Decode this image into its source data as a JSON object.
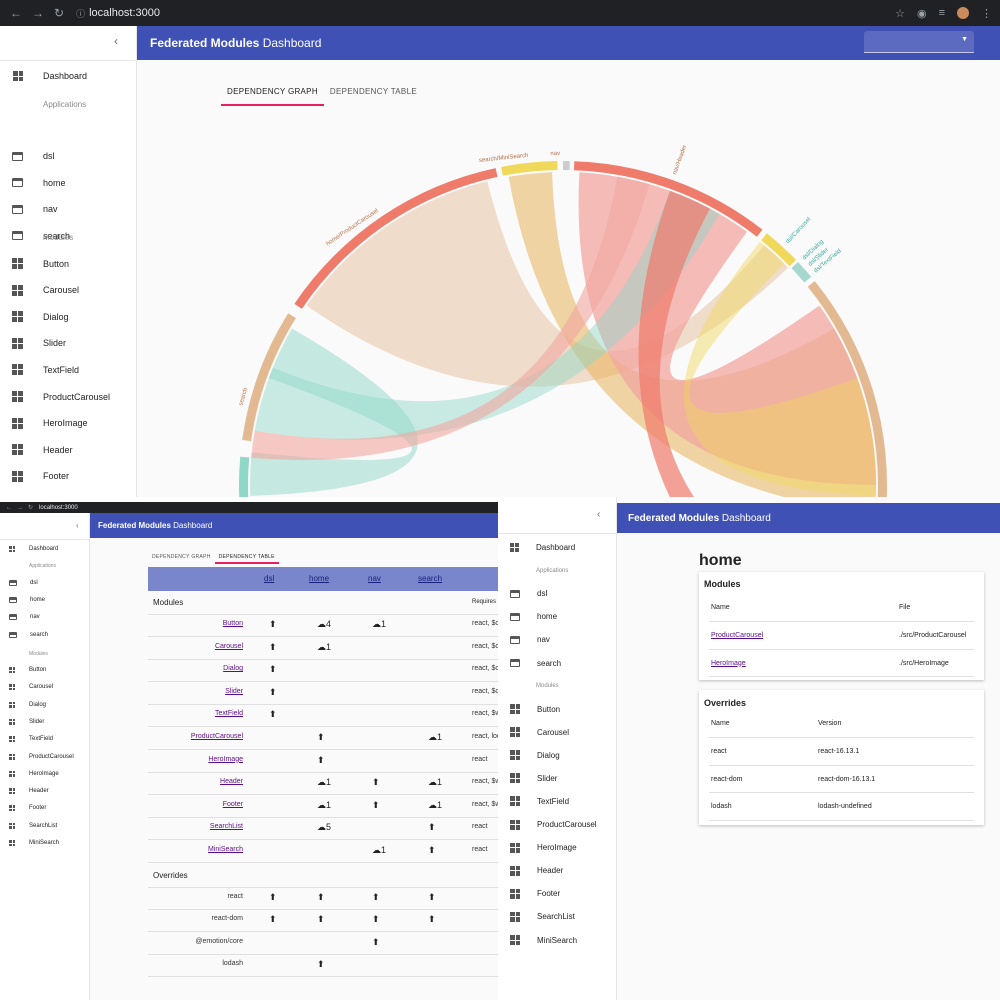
{
  "browser": {
    "url": "localhost:3000",
    "url_small": "localhost:3000"
  },
  "app": {
    "title_bold": "Federated Modules",
    "title_rest": " Dashboard"
  },
  "sidebar": {
    "dashboard": "Dashboard",
    "applications_header": "Applications",
    "applications": [
      "dsl",
      "home",
      "nav",
      "search"
    ],
    "modules_header": "Modules",
    "modules_p1": [
      "Button",
      "Carousel",
      "Dialog",
      "Slider",
      "TextField",
      "ProductCarousel",
      "HeroImage",
      "Header",
      "Footer"
    ],
    "modules": [
      "Button",
      "Carousel",
      "Dialog",
      "Slider",
      "TextField",
      "ProductCarousel",
      "HeroImage",
      "Header",
      "Footer",
      "SearchList",
      "MiniSearch"
    ]
  },
  "tabs": [
    "Dependency Graph",
    "Dependency Table"
  ],
  "graph": {
    "labels": [
      "search/MiniSearch",
      "nav",
      "home/ProductCarousel",
      "search",
      "nav/Header",
      "dsl/Carousel",
      "dsl/Dialog",
      "dsl/Slider",
      "dsl/TextField"
    ],
    "colors": {
      "salmon": "#ef7b6b",
      "yellow": "#f0d85a",
      "tan": "#e2b991",
      "teal": "#8fd7c7",
      "pink": "#f2a6a0"
    }
  },
  "table": {
    "apps": [
      "dsl",
      "home",
      "nav",
      "search"
    ],
    "modules_title": "Modules",
    "requires_title": "Requires",
    "overrides_title": "Overrides",
    "module_rows": [
      {
        "name": "Button",
        "link": true,
        "marks": [
          "⬆",
          "☁4",
          "☁1",
          ""
        ],
        "req": "react, $c"
      },
      {
        "name": "Carousel",
        "link": true,
        "marks": [
          "⬆",
          "☁1",
          "",
          ""
        ],
        "req": "react, $c"
      },
      {
        "name": "Dialog",
        "link": true,
        "marks": [
          "⬆",
          "",
          "",
          ""
        ],
        "req": "react, $c"
      },
      {
        "name": "Slider",
        "link": true,
        "marks": [
          "⬆",
          "",
          "",
          ""
        ],
        "req": "react, $c"
      },
      {
        "name": "TextField",
        "link": true,
        "marks": [
          "⬆",
          "",
          "",
          ""
        ],
        "req": "react, $w"
      },
      {
        "name": "ProductCarousel",
        "link": true,
        "marks": [
          "",
          "⬆",
          "",
          "☁1"
        ],
        "req": "react, lod"
      },
      {
        "name": "HeroImage",
        "link": true,
        "marks": [
          "",
          "⬆",
          "",
          ""
        ],
        "req": "react"
      },
      {
        "name": "Header",
        "link": true,
        "marks": [
          "",
          "☁1",
          "⬆",
          "☁1"
        ],
        "req": "react, $w"
      },
      {
        "name": "Footer",
        "link": true,
        "marks": [
          "",
          "☁1",
          "⬆",
          "☁1"
        ],
        "req": "react, $w"
      },
      {
        "name": "SearchList",
        "link": true,
        "marks": [
          "",
          "☁5",
          "",
          "⬆"
        ],
        "req": "react"
      },
      {
        "name": "MiniSearch",
        "link": true,
        "marks": [
          "",
          "",
          "☁1",
          "⬆"
        ],
        "req": "react"
      }
    ],
    "override_rows": [
      {
        "name": "react",
        "marks": [
          "⬆",
          "⬆",
          "⬆",
          "⬆"
        ]
      },
      {
        "name": "react-dom",
        "marks": [
          "⬆",
          "⬆",
          "⬆",
          "⬆"
        ]
      },
      {
        "name": "@emotion/core",
        "marks": [
          "",
          "",
          "⬆",
          ""
        ]
      },
      {
        "name": "lodash",
        "marks": [
          "",
          "⬆",
          "",
          ""
        ]
      }
    ]
  },
  "detail": {
    "title": "home",
    "modules_title": "Modules",
    "col_name": "Name",
    "col_file": "File",
    "modules": [
      {
        "name": "ProductCarousel",
        "file": "./src/ProductCarousel"
      },
      {
        "name": "HeroImage",
        "file": "./src/HeroImage"
      }
    ],
    "overrides_title": "Overrides",
    "col_version": "Version",
    "overrides": [
      {
        "name": "react",
        "version": "react-16.13.1"
      },
      {
        "name": "react-dom",
        "version": "react-dom-16.13.1"
      },
      {
        "name": "lodash",
        "version": "lodash-undefined"
      }
    ]
  },
  "icons": {
    "back": "arrow-left-icon",
    "forward": "arrow-right-icon",
    "reload": "reload-icon",
    "collapse": "chevron-left-icon",
    "dropdown": "caret-down-icon"
  }
}
